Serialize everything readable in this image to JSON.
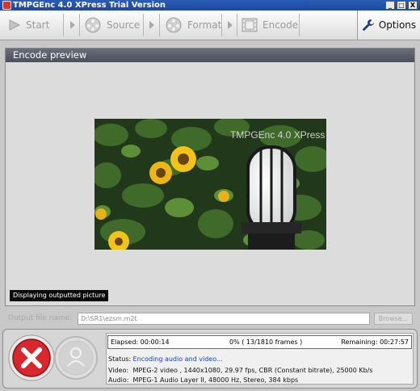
{
  "window": {
    "title": "TMPGEnc 4.0 XPress Trial Version",
    "controls": [
      "_",
      "□",
      "X"
    ]
  },
  "toolbar": {
    "start": "Start",
    "source": "Source",
    "format": "Format",
    "encode": "Encode",
    "options": "Options"
  },
  "preview": {
    "header": "Encode preview",
    "video_overlay": "TMPGEnc 4.0 XPress",
    "status_tag": "Displaying outputted picture"
  },
  "output": {
    "label": "Output file name:",
    "path": "D:\\SR1\\ezsm.m2t",
    "browse": "Browse..."
  },
  "progress": {
    "elapsed_label": "Elapsed: 00:00:14",
    "percent_text": "0% ( 13/1810  frames )",
    "remaining_label": "Remaining: 00:27:57",
    "fraction": 0.007
  },
  "info": {
    "status_key": "Status:",
    "status_val": "Encoding audio and video...",
    "video_key": "Video:",
    "video_val": "MPEG-2 video , 1440x1080, 29.97 fps, CBR (Constant bitrate), 25000 Kb/s",
    "audio_key": "Audio:",
    "audio_val": "MPEG-1 Audio Layer II, 48000 Hz, Stereo, 384 kbps"
  },
  "colors": {
    "titlebar": "#1e47a0",
    "cancel": "#d8282e",
    "status_blue": "#0b46c8"
  }
}
